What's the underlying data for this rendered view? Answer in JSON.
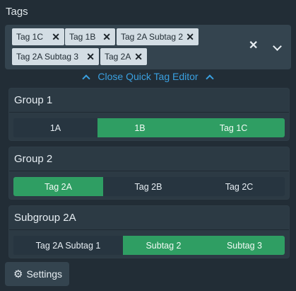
{
  "title": "Tags",
  "selected_tags": [
    {
      "label": "Tag 1C"
    },
    {
      "label": "Tag 1B"
    },
    {
      "label": "Tag 2A Subtag 2"
    },
    {
      "label": "Tag 2A Subtag 3"
    },
    {
      "label": "Tag 2A"
    }
  ],
  "quick_editor": {
    "label": "Close Quick Tag Editor"
  },
  "groups": [
    {
      "title": "Group 1",
      "options": [
        {
          "label": "1A",
          "selected": false
        },
        {
          "label": "1B",
          "selected": true
        },
        {
          "label": "Tag 1C",
          "selected": true
        }
      ]
    },
    {
      "title": "Group 2",
      "options": [
        {
          "label": "Tag 2A",
          "selected": true
        },
        {
          "label": "Tag 2B",
          "selected": false
        },
        {
          "label": "Tag 2C",
          "selected": false
        }
      ]
    },
    {
      "title": "Subgroup 2A",
      "options": [
        {
          "label": "Tag 2A Subtag 1",
          "selected": false
        },
        {
          "label": "Subtag 2",
          "selected": true
        },
        {
          "label": "Subtag 3",
          "selected": true
        }
      ]
    }
  ],
  "settings": {
    "label": "Settings"
  },
  "colors": {
    "accent_green": "#2f9e63",
    "link_blue": "#3aa0e0",
    "background": "#222d36"
  }
}
